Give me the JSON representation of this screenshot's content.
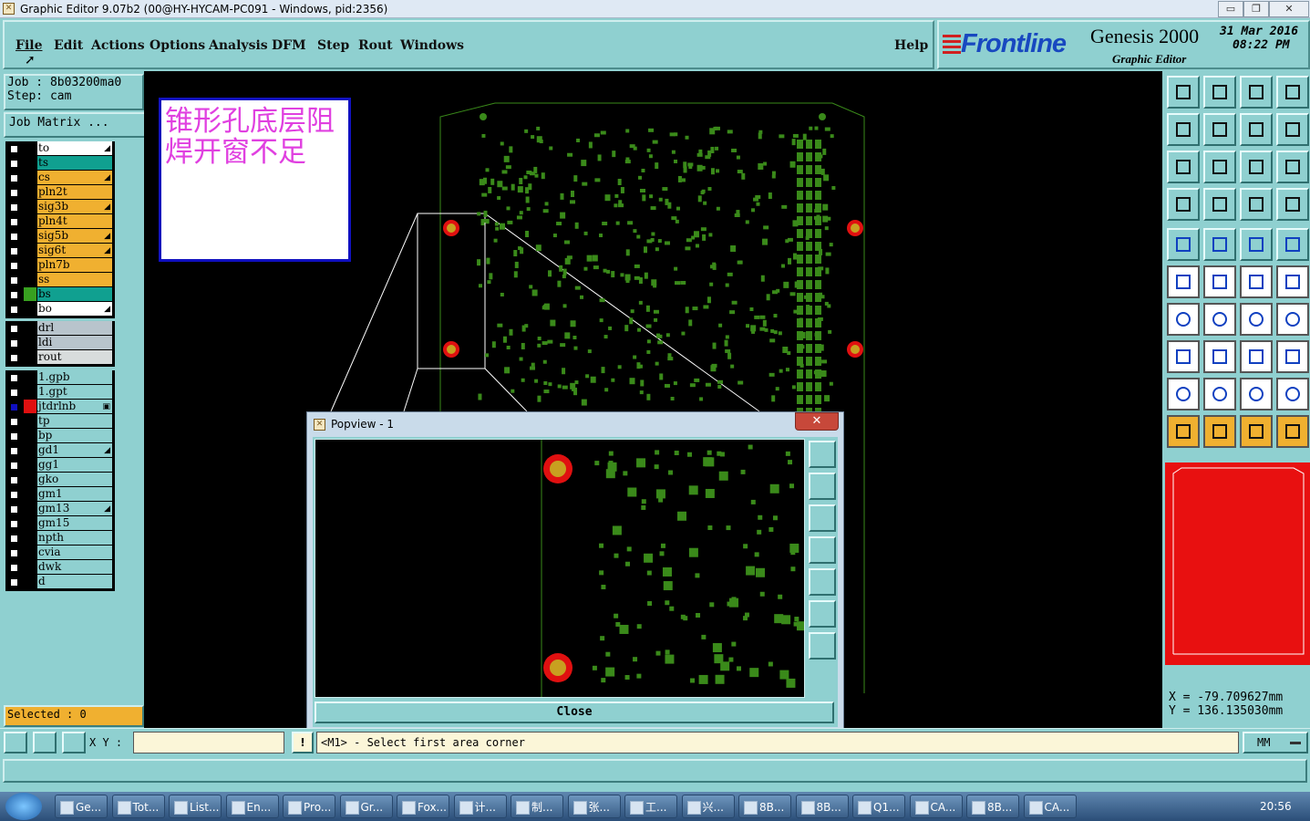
{
  "window": {
    "title": "Graphic Editor 9.07b2 (00@HY-HYCAM-PC091 - Windows, pid:2356)",
    "controls": [
      "▭",
      "❐",
      "✕"
    ]
  },
  "menu": {
    "items": [
      "File",
      "Edit",
      "Actions",
      "Options",
      "Analysis",
      "DFM",
      "Step",
      "Rout",
      "Windows"
    ],
    "help": "Help"
  },
  "brand": {
    "logo": "Frontline",
    "product": "Genesis 2000",
    "subtitle": "Graphic Editor",
    "date": "31 Mar 2016",
    "time": "08:22 PM"
  },
  "job": {
    "job_line": "Job : 8b03200ma0",
    "step_line": "Step: cam",
    "matrix_button": "Job Matrix ..."
  },
  "layers_board": [
    {
      "name": "to",
      "color": "#ffffff",
      "mark": "◢"
    },
    {
      "name": "ts",
      "color": "#10a090",
      "mark": ""
    },
    {
      "name": "cs",
      "color": "#f0b030",
      "mark": "◢"
    },
    {
      "name": "pln2t",
      "color": "#f0b030",
      "mark": ""
    },
    {
      "name": "sig3b",
      "color": "#f0b030",
      "mark": "◢"
    },
    {
      "name": "pln4t",
      "color": "#f0b030",
      "mark": ""
    },
    {
      "name": "sig5b",
      "color": "#f0b030",
      "mark": "◢"
    },
    {
      "name": "sig6t",
      "color": "#f0b030",
      "mark": "◢"
    },
    {
      "name": "pln7b",
      "color": "#f0b030",
      "mark": ""
    },
    {
      "name": "ss",
      "color": "#f0b030",
      "mark": ""
    },
    {
      "name": "bs",
      "color": "#10a090",
      "mark": "",
      "active_swatch": "#38a020"
    },
    {
      "name": "bo",
      "color": "#ffffff",
      "mark": "◢"
    }
  ],
  "layers_drill": [
    {
      "name": "drl",
      "color": "#b8c4cc"
    },
    {
      "name": "ldi",
      "color": "#b8c4cc"
    },
    {
      "name": "rout",
      "color": "#d8dcdc"
    }
  ],
  "layers_misc": [
    {
      "name": "1.gpb",
      "color": "#8fd0d0",
      "mark": ""
    },
    {
      "name": "1.gpt",
      "color": "#8fd0d0",
      "mark": ""
    },
    {
      "name": "jtdrlnb",
      "color": "#8fd0d0",
      "mark": "▣",
      "active_swatch": "#e01010"
    },
    {
      "name": "tp",
      "color": "#8fd0d0",
      "mark": ""
    },
    {
      "name": "bp",
      "color": "#8fd0d0",
      "mark": ""
    },
    {
      "name": "gd1",
      "color": "#8fd0d0",
      "mark": "◢"
    },
    {
      "name": "gg1",
      "color": "#8fd0d0",
      "mark": ""
    },
    {
      "name": "gko",
      "color": "#8fd0d0",
      "mark": ""
    },
    {
      "name": "gm1",
      "color": "#8fd0d0",
      "mark": ""
    },
    {
      "name": "gm13",
      "color": "#8fd0d0",
      "mark": "◢"
    },
    {
      "name": "gm15",
      "color": "#8fd0d0",
      "mark": ""
    },
    {
      "name": "npth",
      "color": "#8fd0d0",
      "mark": ""
    },
    {
      "name": "cvia",
      "color": "#8fd0d0",
      "mark": ""
    },
    {
      "name": "dwk",
      "color": "#8fd0d0",
      "mark": ""
    },
    {
      "name": "d",
      "color": "#8fd0d0",
      "mark": ""
    }
  ],
  "selected": "Selected : 0",
  "annotation": {
    "text": "锥形孔底层阻焊开窗不足",
    "color": "#e040e0"
  },
  "coords": {
    "x_line": "X = -79.709627mm",
    "y_line": "Y = 136.135030mm"
  },
  "popview": {
    "title": "Popview - 1",
    "close_x": "✕",
    "close_button": "Close"
  },
  "cmdbar": {
    "xy_label": "X Y :",
    "xy_value": "",
    "warn": "!",
    "prompt": "<M1> - Select first area corner",
    "units": "MM"
  },
  "taskbar": {
    "items": [
      "Ge...",
      "Tot...",
      "List...",
      "En...",
      "Pro...",
      "Gr...",
      "Fox...",
      "计...",
      "制...",
      "张...",
      "工...",
      "兴...",
      "8B...",
      "8B...",
      "Q1...",
      "CA...",
      "8B...",
      "CA..."
    ],
    "clock": "20:56"
  },
  "colors": {
    "panel": "#8fd0d0",
    "pad_green": "#3a8a1a",
    "hole_red": "#e01010",
    "hole_core": "#c8a020",
    "overview_red": "#e81010"
  },
  "icons": {
    "toolbar_right": [
      "fit-icon",
      "zoom-home-icon",
      "pan-icon",
      "window-icon",
      "pan-left-icon",
      "pan-right-icon",
      "rotate-icon",
      "flip-icon",
      "zoom-fit-icon",
      "zoom-center-icon",
      "scale-1-2-icon",
      "help-icon",
      "measure-icon",
      "grid-icon",
      "snap-red-icon",
      "snap-red2-icon",
      "pad-icon",
      "line-color-icon",
      "ruler-icon",
      "circle-icon",
      "net-icon",
      "cross-icon",
      "connect-icon",
      "connect2-icon",
      "angle-icon",
      "slash-icon",
      "arc-icon",
      "text-icon",
      "move-icon",
      "minus-icon",
      "dimension-icon",
      "copy-icon",
      "triangle-icon",
      "triangle2-icon",
      "a-shape-icon",
      "a-shape2-icon",
      "select-arrow-icon",
      "select-box-icon",
      "select-round-icon",
      "select-net-icon"
    ]
  }
}
